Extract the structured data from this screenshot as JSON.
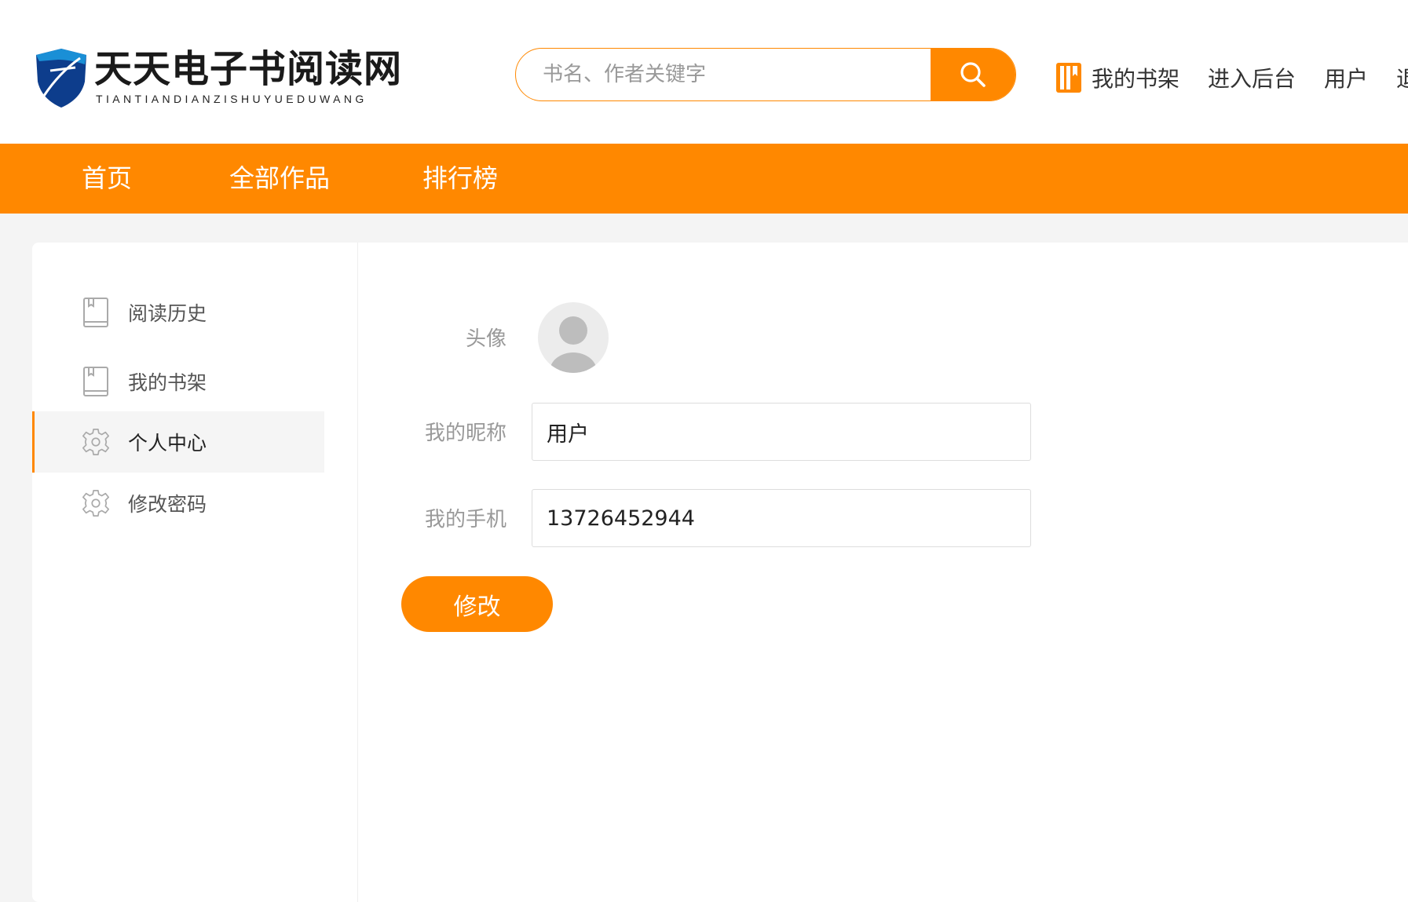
{
  "header": {
    "logo_title": "天天电子书阅读网",
    "logo_subtitle": "TIANTIANDIANZISHUYUEDUWANG",
    "search_placeholder": "书名、作者关键字",
    "search_icon": "search-icon",
    "links": {
      "bookshelf": "我的书架",
      "admin": "进入后台",
      "user": "用户",
      "logout": "退"
    }
  },
  "nav": {
    "items": [
      "首页",
      "全部作品",
      "排行榜"
    ]
  },
  "sidebar": {
    "items": [
      {
        "label": "阅读历史",
        "icon": "book-icon"
      },
      {
        "label": "我的书架",
        "icon": "book-icon"
      },
      {
        "label": "个人中心",
        "icon": "gear-icon",
        "active": true
      },
      {
        "label": "修改密码",
        "icon": "gear-icon"
      }
    ]
  },
  "profile": {
    "avatar_label": "头像",
    "nickname_label": "我的昵称",
    "nickname_value": "用户",
    "phone_label": "我的手机",
    "phone_value": "13726452944",
    "submit_label": "修改"
  },
  "colors": {
    "accent": "#ff8800",
    "background": "#f4f4f4",
    "logo_blue": "#0d3d8c"
  }
}
